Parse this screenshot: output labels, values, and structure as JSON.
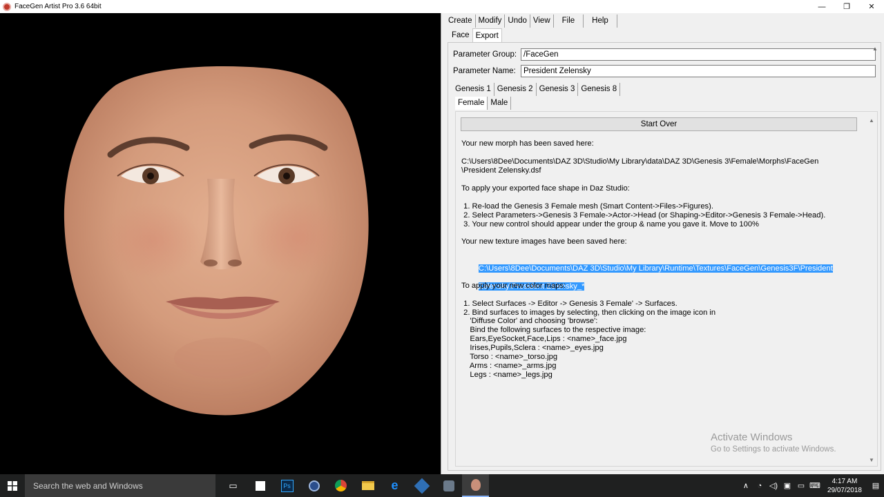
{
  "window": {
    "title": "FaceGen Artist Pro 3.6 64bit",
    "controls": [
      "—",
      "❐",
      "✕"
    ]
  },
  "menu_tabs": [
    "Create",
    "Modify",
    "Undo",
    "View",
    "File",
    "Help"
  ],
  "sub_tabs": [
    "Face",
    "Export"
  ],
  "params": {
    "group_label": "Parameter Group:",
    "group_value": "/FaceGen",
    "name_label": "Parameter Name:",
    "name_value": "President Zelensky"
  },
  "genesis_tabs": [
    "Genesis 1",
    "Genesis 2",
    "Genesis 3",
    "Genesis 8"
  ],
  "sex_tabs": [
    "Female",
    "Male"
  ],
  "start_over": "Start Over",
  "content": {
    "saved_heading": "Your new morph has been saved here:",
    "morph_path_1": "C:\\Users\\8Dee\\Documents\\DAZ 3D\\Studio\\My Library\\data\\DAZ 3D\\Genesis 3\\Female\\Morphs\\FaceGen",
    "morph_path_2": "\\President Zelensky.dsf",
    "apply_heading": "To apply your exported face shape in Daz Studio:",
    "step1": " 1. Re-load the Genesis 3 Female mesh (Smart Content->Files->Figures).",
    "step2": " 2. Select Parameters->Genesis 3 Female->Actor->Head (or Shaping->Editor->Genesis 3 Female->Head).",
    "step3": " 3. Your new control should appear under the group & name you gave it. Move to 100%",
    "texture_heading": "Your new texture images have been saved here:",
    "texture_path_1": "C:\\Users\\8Dee\\Documents\\DAZ 3D\\Studio\\My Library\\Runtime\\Textures\\FaceGen\\Genesis3F\\President",
    "texture_path_2": "Zelensky\\President Zelensky_*",
    "color_heading": "To apply your new color maps:",
    "c1": " 1. Select Surfaces -> Editor -> Genesis 3 Female' -> Surfaces.",
    "c2": " 2. Bind surfaces to images by selecting, then clicking on the image icon in",
    "c3": "    'Diffuse Color' and choosing 'browse':",
    "c4": "    Bind the following surfaces to the respective image:",
    "c5": "    Ears,EyeSocket,Face,Lips : <name>_face.jpg",
    "c6": "    Irises,Pupils,Sclera : <name>_eyes.jpg",
    "c7": "    Torso : <name>_torso.jpg",
    "c8": "    Arms : <name>_arms.jpg",
    "c9": "    Legs : <name>_legs.jpg"
  },
  "watermark": {
    "line1": "Activate Windows",
    "line2": "Go to Settings to activate Windows."
  },
  "taskbar": {
    "search_placeholder": "Search the web and Windows",
    "time": "4:17 AM",
    "date": "29/07/2018"
  },
  "colors": {
    "accent_selection": "#3399ff",
    "viewport_bg": "#000000",
    "taskbar_bg": "#1f2020"
  }
}
